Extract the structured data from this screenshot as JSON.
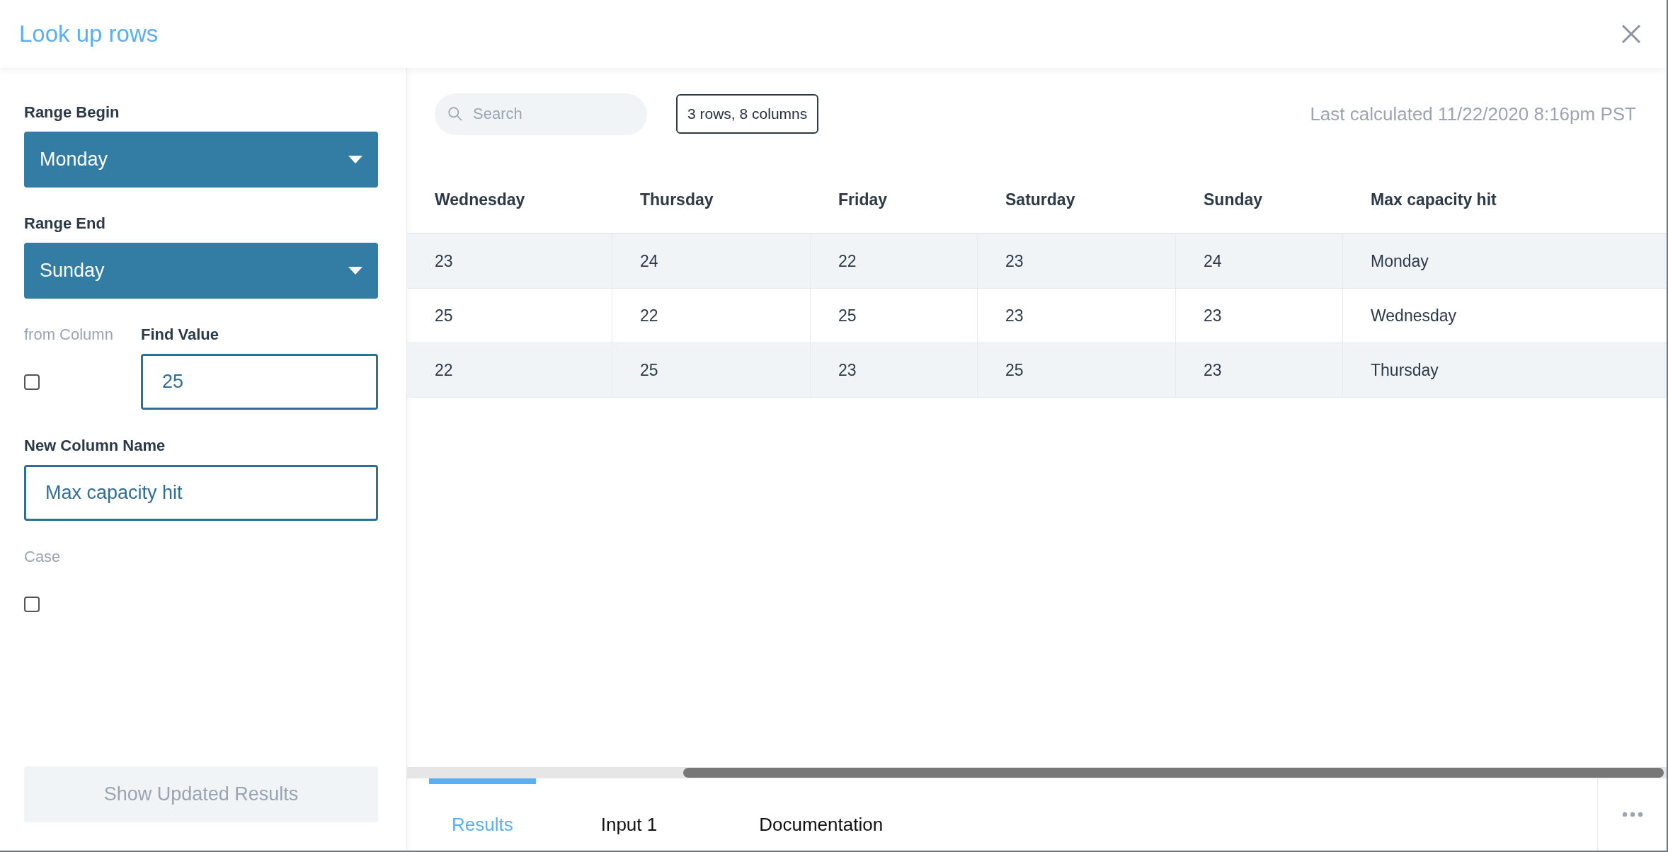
{
  "dialog": {
    "title": "Look up rows"
  },
  "form": {
    "range_begin": {
      "label": "Range Begin",
      "value": "Monday"
    },
    "range_end": {
      "label": "Range End",
      "value": "Sunday"
    },
    "from_column": {
      "label": "from Column",
      "checked": false
    },
    "find_value": {
      "label": "Find Value",
      "value": "25"
    },
    "new_column_name": {
      "label": "New Column Name",
      "value": "Max capacity hit"
    },
    "case": {
      "label": "Case",
      "checked": false
    },
    "submit": {
      "label": "Show Updated Results",
      "disabled": true
    }
  },
  "toolbar": {
    "search": {
      "placeholder": "Search"
    },
    "summary": "3 rows, 8 columns",
    "last_calculated": "Last calculated 11/22/2020 8:16pm PST"
  },
  "table": {
    "columns": [
      "Wednesday",
      "Thursday",
      "Friday",
      "Saturday",
      "Sunday",
      "Max capacity hit"
    ],
    "rows": [
      [
        "23",
        "24",
        "22",
        "23",
        "24",
        "Monday"
      ],
      [
        "25",
        "22",
        "25",
        "23",
        "23",
        "Wednesday"
      ],
      [
        "22",
        "25",
        "23",
        "25",
        "23",
        "Thursday"
      ]
    ]
  },
  "tabs": [
    {
      "label": "Results",
      "selected": true
    },
    {
      "label": "Input 1",
      "selected": false
    },
    {
      "label": "Documentation",
      "selected": false
    }
  ]
}
